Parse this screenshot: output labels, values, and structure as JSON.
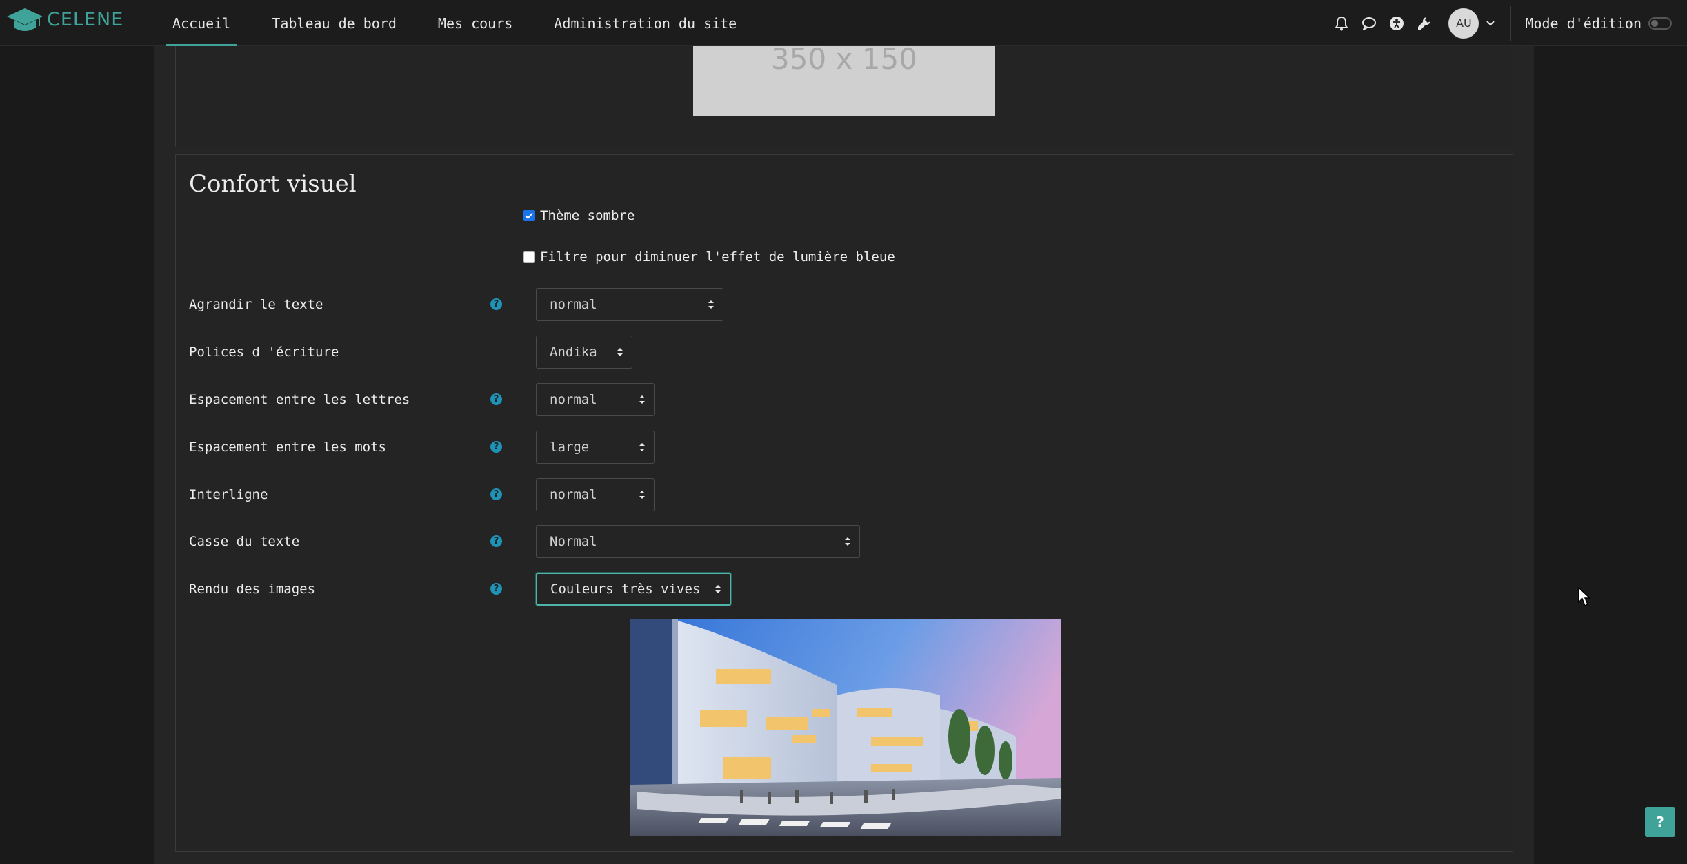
{
  "brand": {
    "name": "CELENE"
  },
  "nav": {
    "links": [
      {
        "label": "Accueil",
        "active": true
      },
      {
        "label": "Tableau de bord",
        "active": false
      },
      {
        "label": "Mes cours",
        "active": false
      },
      {
        "label": "Administration du site",
        "active": false
      }
    ],
    "icons": [
      "bell-icon",
      "chat-icon",
      "accessibility-icon",
      "wrench-icon"
    ],
    "avatar_initials": "AU",
    "edit_mode_label": "Mode d'édition",
    "edit_mode_on": false
  },
  "top_card": {
    "placeholder_text": "350 x 150"
  },
  "visual_comfort": {
    "title": "Confort visuel",
    "checkboxes": [
      {
        "label": "Thème sombre",
        "checked": true
      },
      {
        "label": "Filtre pour diminuer l'effet de lumière bleue",
        "checked": false
      }
    ],
    "fields": [
      {
        "label": "Agrandir le texte",
        "value": "normal",
        "help": true
      },
      {
        "label": "Polices d 'écriture",
        "value": "Andika",
        "help": false
      },
      {
        "label": "Espacement entre les lettres",
        "value": "normal",
        "help": true
      },
      {
        "label": "Espacement entre les mots",
        "value": "large",
        "help": true
      },
      {
        "label": "Interligne",
        "value": "normal",
        "help": true
      },
      {
        "label": "Casse du texte",
        "value": "Normal",
        "help": true
      },
      {
        "label": "Rendu des images",
        "value": "Couleurs très vives",
        "help": true
      }
    ],
    "preview_image": "building-photo"
  },
  "help_button": {
    "label": "?"
  },
  "colors": {
    "accent": "#3fa39a",
    "help_icon": "#1f93b5",
    "checkbox": "#1a73e8"
  }
}
